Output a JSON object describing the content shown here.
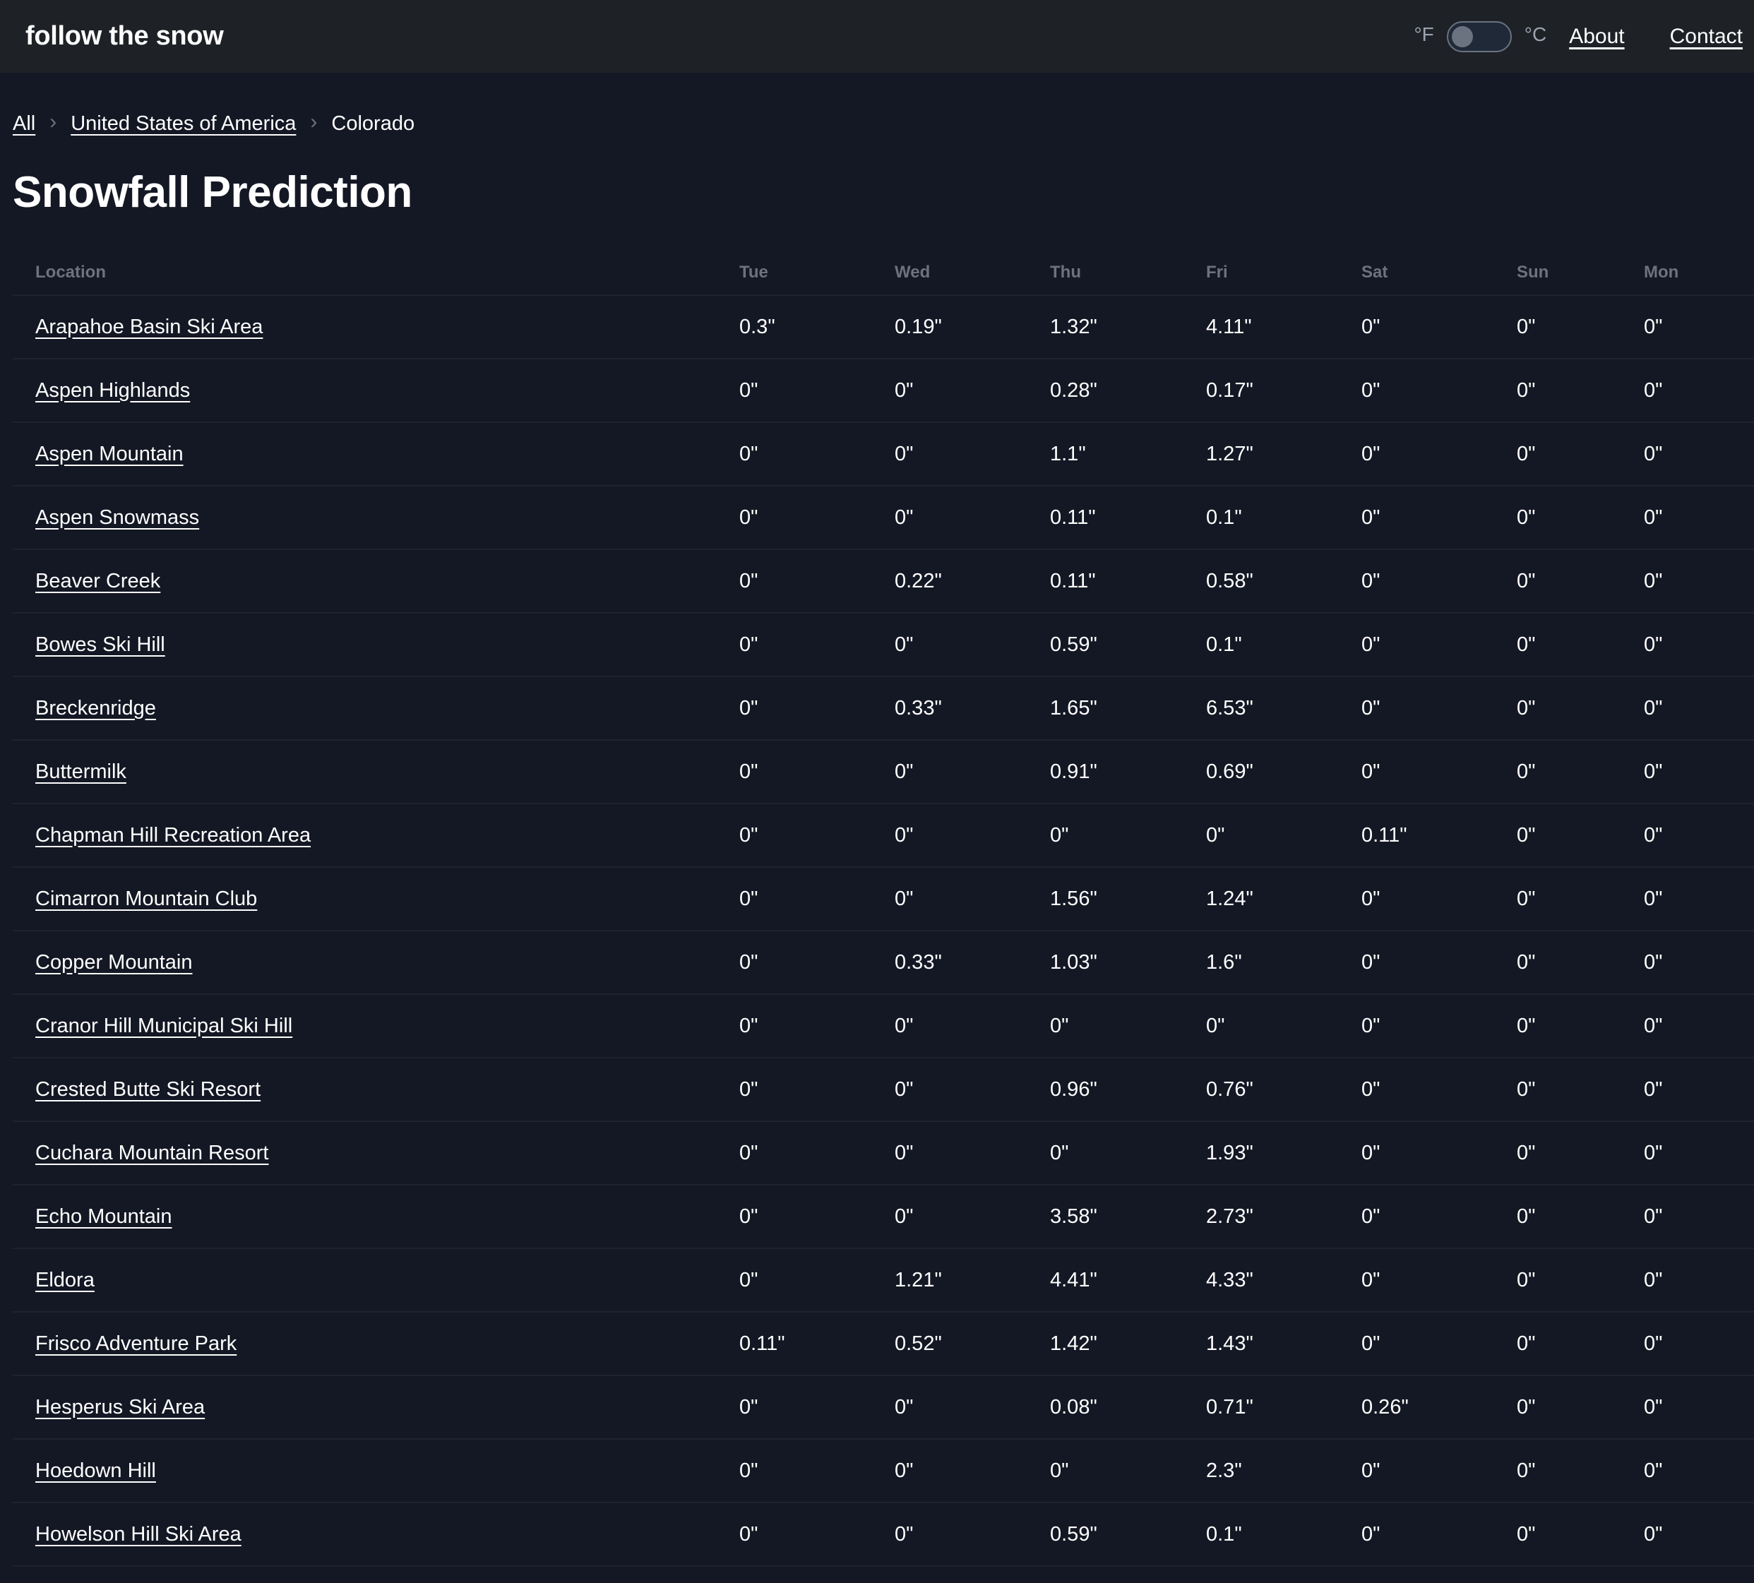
{
  "header": {
    "brand": "follow the snow",
    "unit_f": "°F",
    "unit_c": "°C",
    "about": "About",
    "contact": "Contact"
  },
  "breadcrumb": {
    "all": "All",
    "country": "United States of America",
    "current": "Colorado"
  },
  "page_title": "Snowfall Prediction",
  "table": {
    "columns": [
      "Location",
      "Tue",
      "Wed",
      "Thu",
      "Fri",
      "Sat",
      "Sun",
      "Mon"
    ],
    "rows": [
      {
        "location": "Arapahoe Basin Ski Area",
        "values": [
          "0.3\"",
          "0.19\"",
          "1.32\"",
          "4.11\"",
          "0\"",
          "0\"",
          "0\""
        ]
      },
      {
        "location": "Aspen Highlands",
        "values": [
          "0\"",
          "0\"",
          "0.28\"",
          "0.17\"",
          "0\"",
          "0\"",
          "0\""
        ]
      },
      {
        "location": "Aspen Mountain",
        "values": [
          "0\"",
          "0\"",
          "1.1\"",
          "1.27\"",
          "0\"",
          "0\"",
          "0\""
        ]
      },
      {
        "location": "Aspen Snowmass",
        "values": [
          "0\"",
          "0\"",
          "0.11\"",
          "0.1\"",
          "0\"",
          "0\"",
          "0\""
        ]
      },
      {
        "location": "Beaver Creek",
        "values": [
          "0\"",
          "0.22\"",
          "0.11\"",
          "0.58\"",
          "0\"",
          "0\"",
          "0\""
        ]
      },
      {
        "location": "Bowes Ski Hill",
        "values": [
          "0\"",
          "0\"",
          "0.59\"",
          "0.1\"",
          "0\"",
          "0\"",
          "0\""
        ]
      },
      {
        "location": "Breckenridge",
        "values": [
          "0\"",
          "0.33\"",
          "1.65\"",
          "6.53\"",
          "0\"",
          "0\"",
          "0\""
        ]
      },
      {
        "location": "Buttermilk",
        "values": [
          "0\"",
          "0\"",
          "0.91\"",
          "0.69\"",
          "0\"",
          "0\"",
          "0\""
        ]
      },
      {
        "location": "Chapman Hill Recreation Area",
        "values": [
          "0\"",
          "0\"",
          "0\"",
          "0\"",
          "0.11\"",
          "0\"",
          "0\""
        ]
      },
      {
        "location": "Cimarron Mountain Club",
        "values": [
          "0\"",
          "0\"",
          "1.56\"",
          "1.24\"",
          "0\"",
          "0\"",
          "0\""
        ]
      },
      {
        "location": "Copper Mountain",
        "values": [
          "0\"",
          "0.33\"",
          "1.03\"",
          "1.6\"",
          "0\"",
          "0\"",
          "0\""
        ]
      },
      {
        "location": "Cranor Hill Municipal Ski Hill",
        "values": [
          "0\"",
          "0\"",
          "0\"",
          "0\"",
          "0\"",
          "0\"",
          "0\""
        ]
      },
      {
        "location": "Crested Butte Ski Resort",
        "values": [
          "0\"",
          "0\"",
          "0.96\"",
          "0.76\"",
          "0\"",
          "0\"",
          "0\""
        ]
      },
      {
        "location": "Cuchara Mountain Resort",
        "values": [
          "0\"",
          "0\"",
          "0\"",
          "1.93\"",
          "0\"",
          "0\"",
          "0\""
        ]
      },
      {
        "location": "Echo Mountain",
        "values": [
          "0\"",
          "0\"",
          "3.58\"",
          "2.73\"",
          "0\"",
          "0\"",
          "0\""
        ]
      },
      {
        "location": "Eldora",
        "values": [
          "0\"",
          "1.21\"",
          "4.41\"",
          "4.33\"",
          "0\"",
          "0\"",
          "0\""
        ]
      },
      {
        "location": "Frisco Adventure Park",
        "values": [
          "0.11\"",
          "0.52\"",
          "1.42\"",
          "1.43\"",
          "0\"",
          "0\"",
          "0\""
        ]
      },
      {
        "location": "Hesperus Ski Area",
        "values": [
          "0\"",
          "0\"",
          "0.08\"",
          "0.71\"",
          "0.26\"",
          "0\"",
          "0\""
        ]
      },
      {
        "location": "Hoedown Hill",
        "values": [
          "0\"",
          "0\"",
          "0\"",
          "2.3\"",
          "0\"",
          "0\"",
          "0\""
        ]
      },
      {
        "location": "Howelson Hill Ski Area",
        "values": [
          "0\"",
          "0\"",
          "0.59\"",
          "0.1\"",
          "0\"",
          "0\"",
          "0\""
        ]
      }
    ]
  }
}
